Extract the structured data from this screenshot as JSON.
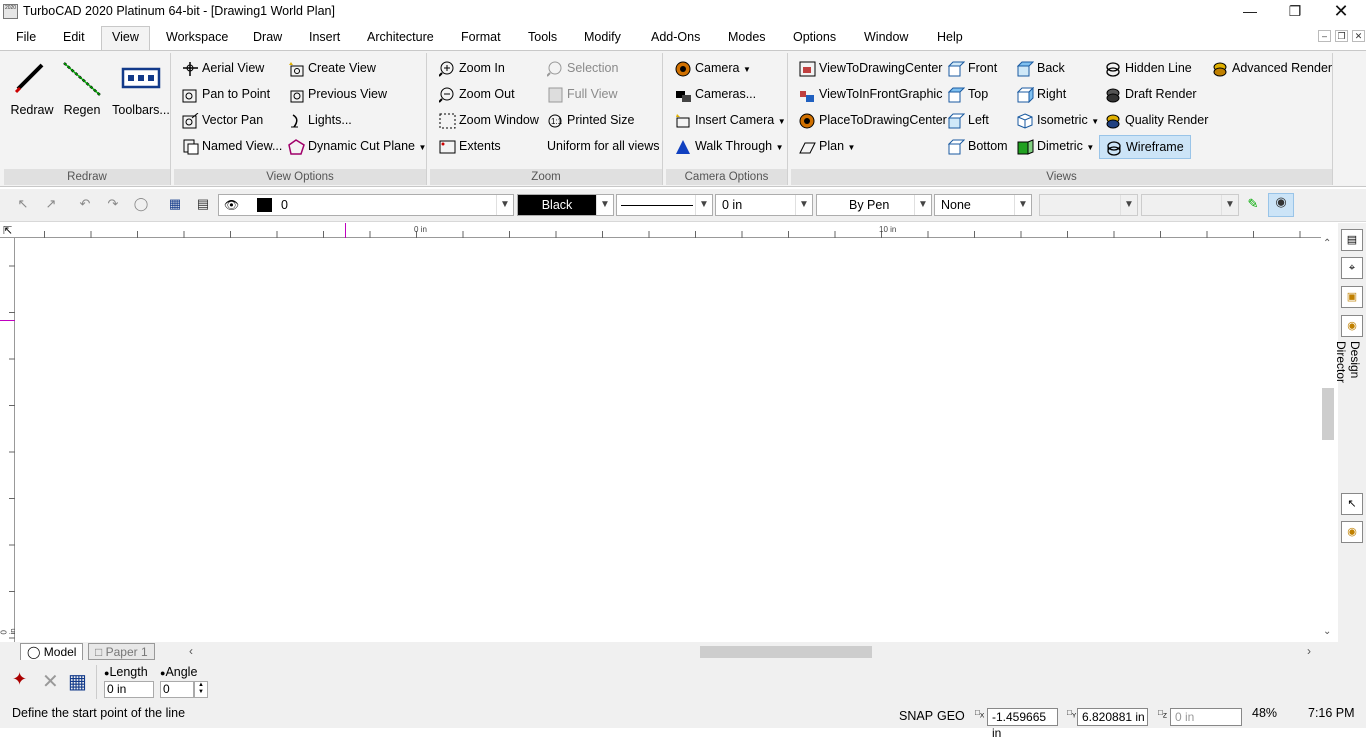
{
  "window": {
    "title": "TurboCAD 2020 Platinum 64-bit - [Drawing1 World Plan]",
    "icon_text": "2020"
  },
  "menu": [
    "File",
    "Edit",
    "View",
    "Workspace",
    "Draw",
    "Insert",
    "Architecture",
    "Format",
    "Tools",
    "Modify",
    "Add-Ons",
    "Modes",
    "Options",
    "Window",
    "Help"
  ],
  "active_menu": "View",
  "ribbon": {
    "redraw": {
      "label": "Redraw",
      "items": [
        "Redraw",
        "Regen",
        "Toolbars..."
      ]
    },
    "view_options": {
      "label": "View Options",
      "col1": [
        "Aerial View",
        "Pan to Point",
        "Vector Pan",
        "Named View..."
      ],
      "col2": [
        "Create View",
        "Previous View",
        "Lights...",
        "Dynamic Cut Plane"
      ]
    },
    "zoom": {
      "label": "Zoom",
      "col1": [
        "Zoom In",
        "Zoom Out",
        "Zoom Window",
        "Extents"
      ],
      "col2": [
        "Selection",
        "Full View",
        "Printed Size",
        "Uniform for all views"
      ]
    },
    "camera_options": {
      "label": "Camera Options",
      "items": [
        "Camera",
        "Cameras...",
        "Insert Camera",
        "Walk Through"
      ]
    },
    "views": {
      "label": "Views",
      "col1": [
        "ViewToDrawingCenter",
        "ViewToInFrontGraphic",
        "PlaceToDrawingCenter",
        "Plan"
      ],
      "col2": [
        "Front",
        "Top",
        "Left",
        "Bottom"
      ],
      "col3": [
        "Back",
        "Right",
        "Isometric",
        "Dimetric"
      ],
      "col4": [
        "Hidden Line",
        "Draft Render",
        "Quality Render",
        "Wireframe"
      ],
      "col5": [
        "Advanced Render"
      ]
    }
  },
  "propbar": {
    "layer": "0",
    "color": "Black",
    "width": "0 in",
    "pen": "By Pen",
    "fill": "None"
  },
  "ruler": {
    "h_labels": [
      "0 in",
      "10 in"
    ],
    "v_label": "0 in"
  },
  "dock": {
    "design_director": "Design Director"
  },
  "tabs": [
    "Model",
    "Paper 1"
  ],
  "inspector": {
    "length_label": "Length",
    "angle_label": "Angle",
    "length_value": "0 in",
    "angle_value": "0"
  },
  "status": {
    "prompt": "Define the start point of the line",
    "snap": "SNAP",
    "geo": "GEO",
    "x_label": "X",
    "y_label": "Y",
    "z_label": "Z",
    "x": "-1.459665 in",
    "y": "6.820881 in",
    "z": "0 in",
    "zoom": "48%",
    "time": "7:16 PM"
  }
}
